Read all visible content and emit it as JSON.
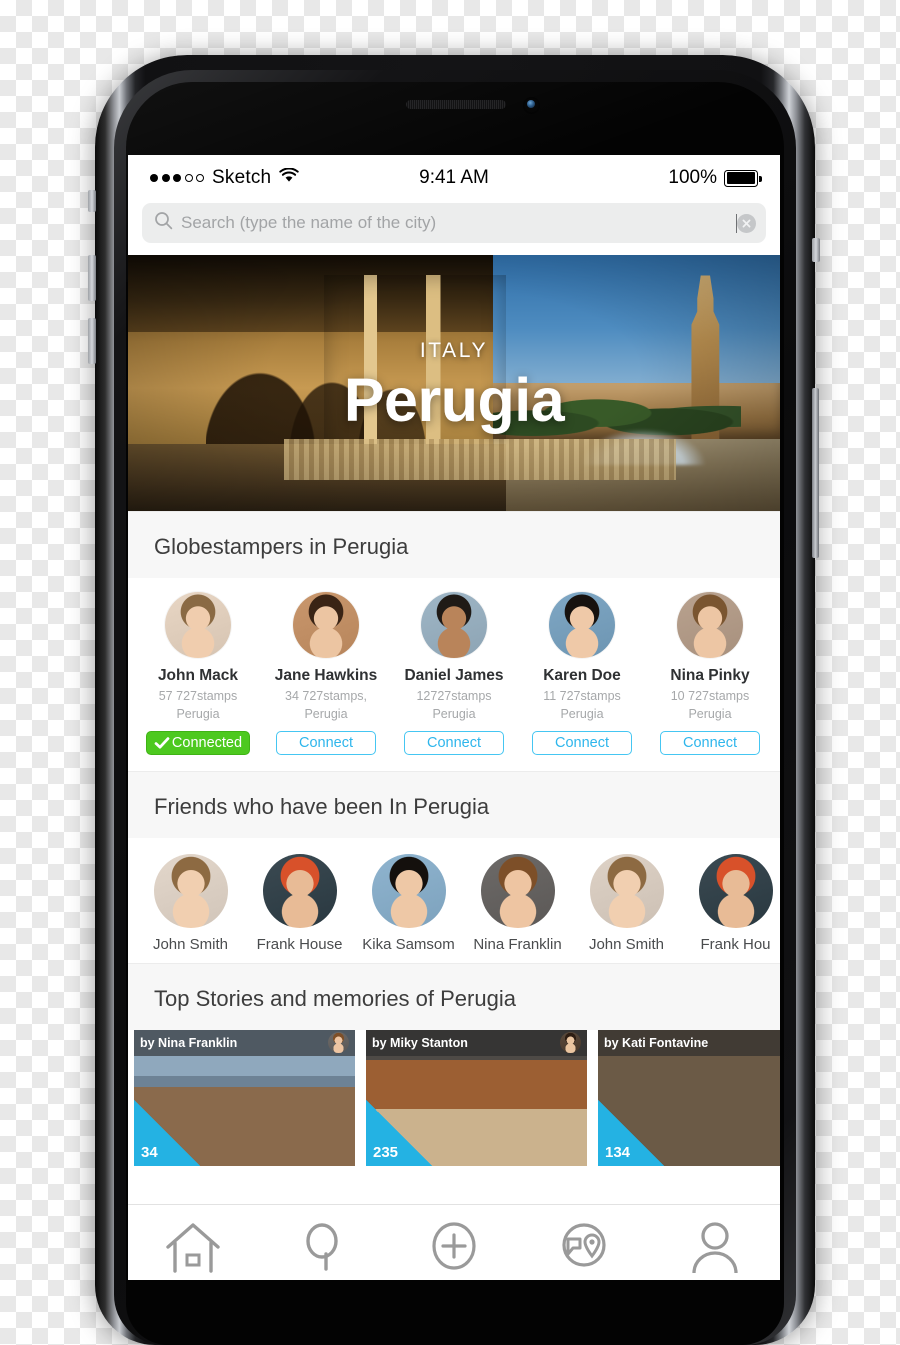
{
  "status_bar": {
    "carrier": "Sketch",
    "signal_dots_filled": 3,
    "signal_dots_total": 5,
    "wifi_icon": "wifi-icon",
    "time": "9:41 AM",
    "battery_percent": "100%",
    "battery_level": 100
  },
  "search": {
    "placeholder": "Search (type the name of the city)",
    "value": "",
    "icon": "search-icon",
    "clear_icon": "clear-circle-icon"
  },
  "hero": {
    "country": "ITALY",
    "city": "Perugia"
  },
  "sections": {
    "globestampers": {
      "title": "Globestampers in Perugia",
      "people": [
        {
          "name": "John Mack",
          "stamps": "57 727stamps",
          "city": "Perugia",
          "action": "Connected",
          "connected": true,
          "avatar_tint": "#e8d6c4"
        },
        {
          "name": "Jane Hawkins",
          "stamps": "34 727stamps,",
          "city": "Perugia",
          "action": "Connect",
          "connected": false,
          "avatar_tint": "#c9976d"
        },
        {
          "name": "Daniel James",
          "stamps": "12727stamps",
          "city": "Perugia",
          "action": "Connect",
          "connected": false,
          "avatar_tint": "#9fb6c6"
        },
        {
          "name": "Karen Doe",
          "stamps": "11 727stamps",
          "city": "Perugia",
          "action": "Connect",
          "connected": false,
          "avatar_tint": "#7fa7c4"
        },
        {
          "name": "Nina Pinky",
          "stamps": "10 727stamps",
          "city": "Perugia",
          "action": "Connect",
          "connected": false,
          "avatar_tint": "#b9a28f"
        }
      ]
    },
    "friends": {
      "title": "Friends who have been In Perugia",
      "people": [
        {
          "name": "John Smith"
        },
        {
          "name": "Frank House"
        },
        {
          "name": "Kika Samsom"
        },
        {
          "name": "Nina Franklin"
        },
        {
          "name": "John Smith"
        },
        {
          "name": "Frank Hou"
        }
      ]
    },
    "stories": {
      "title": "Top Stories and memories of Perugia",
      "cards": [
        {
          "author": "by Nina Franklin",
          "count": "34"
        },
        {
          "author": "by Miky Stanton",
          "count": "235"
        },
        {
          "author": "by Kati Fontavine",
          "count": "134"
        }
      ]
    }
  },
  "tab_bar": {
    "tabs": [
      {
        "icon": "home-icon",
        "label": ""
      },
      {
        "icon": "search-icon",
        "label": ""
      },
      {
        "icon": "add-icon",
        "label": ""
      },
      {
        "icon": "explore-icon",
        "label": ""
      },
      {
        "icon": "profile-icon",
        "label": ""
      }
    ]
  },
  "colors": {
    "accent_cyan": "#24b2e3",
    "connect_border": "#45c6f2",
    "connected_green": "#4dc91f",
    "section_bg": "#f7f7f7"
  }
}
